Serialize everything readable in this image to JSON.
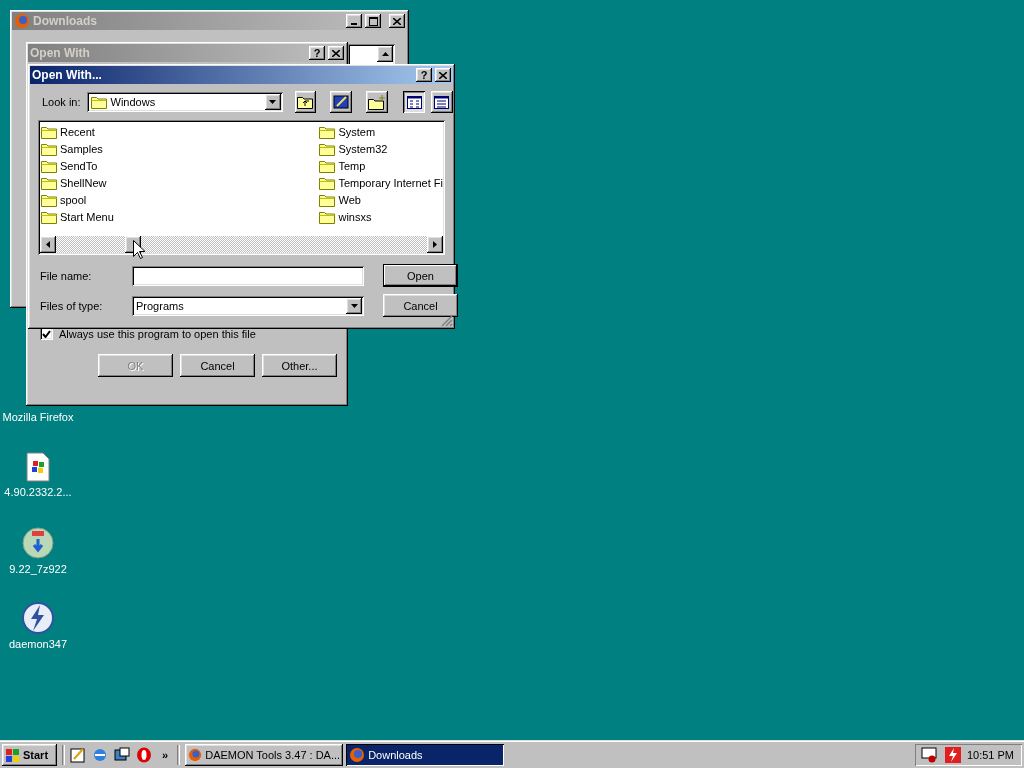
{
  "desktop_icons": [
    {
      "label": "Mozilla Firefox",
      "kind": "covered"
    },
    {
      "label": "4.90.2332.2...",
      "kind": "installer"
    },
    {
      "label": "9.22_7z922",
      "kind": "archive"
    },
    {
      "label": "daemon347",
      "kind": "daemon"
    }
  ],
  "downloads_window": {
    "title": "Downloads"
  },
  "open_with_window": {
    "title": "Open With",
    "help": "?",
    "always_use": {
      "label": "Always use this program to open this file",
      "checked": true
    },
    "buttons": [
      {
        "label": "OK",
        "disabled": true
      },
      {
        "label": "Cancel",
        "disabled": false
      },
      {
        "label": "Other...",
        "disabled": false
      }
    ]
  },
  "open_with_dialog": {
    "title": "Open With...",
    "help": "?",
    "look_in": {
      "label": "Look in:",
      "value": "Windows"
    },
    "view_buttons": [
      {
        "selected": true
      },
      {
        "selected": false
      }
    ],
    "files": [
      [
        "Recent",
        "Samples",
        "SendTo",
        "ShellNew",
        "spool",
        "Start Menu"
      ],
      [
        "System",
        "System32",
        "Temp",
        "Temporary Internet Fi",
        "Web",
        "winsxs"
      ]
    ],
    "file_name": {
      "label": "File name:"
    },
    "file_type": {
      "label": "Files of type:",
      "value": "Programs"
    },
    "buttons": [
      {
        "label": "Open",
        "default": true
      },
      {
        "label": "Cancel",
        "default": false
      }
    ]
  },
  "taskbar": {
    "start": "Start",
    "chevron": "»",
    "tasks": [
      {
        "label": "DAEMON Tools 3.47 : DA...",
        "selected": false
      },
      {
        "label": "Downloads",
        "selected": true
      }
    ],
    "clock": "10:51 PM"
  }
}
